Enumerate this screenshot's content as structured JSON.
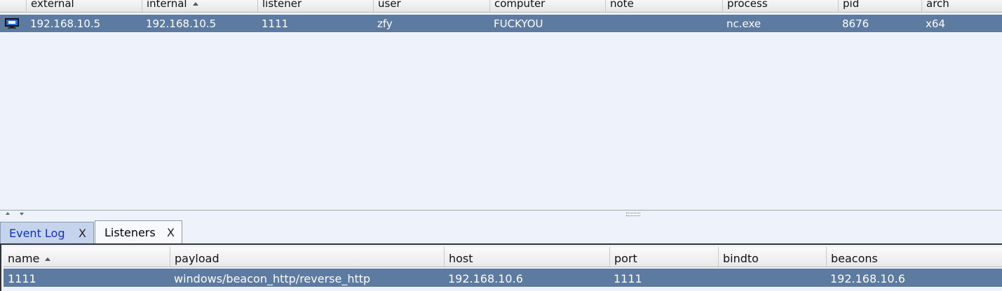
{
  "sessions": {
    "columns": [
      "external",
      "internal",
      "listener",
      "user",
      "computer",
      "note",
      "process",
      "pid",
      "arch"
    ],
    "sorted_column": "internal",
    "rows": [
      {
        "external": "192.168.10.5",
        "internal": "192.168.10.5",
        "listener": "1111",
        "user": "zfy",
        "computer": "FUCKYOU",
        "note": "",
        "process": "nc.exe",
        "pid": "8676",
        "arch": "x64",
        "icon": "monitor-icon"
      }
    ]
  },
  "tabs": [
    {
      "label": "Event Log",
      "close": "X"
    },
    {
      "label": "Listeners",
      "close": "X"
    }
  ],
  "listeners": {
    "columns": [
      "name",
      "payload",
      "host",
      "port",
      "bindto",
      "beacons"
    ],
    "sorted_column": "name",
    "rows": [
      {
        "name": "1111",
        "payload": "windows/beacon_http/reverse_http",
        "host": "192.168.10.6",
        "port": "1111",
        "bindto": "",
        "beacons": "192.168.10.6"
      }
    ]
  },
  "colors": {
    "selection": "#5d7ba0",
    "panel": "#eef2fb",
    "active_tab_text": "#1330c8"
  }
}
